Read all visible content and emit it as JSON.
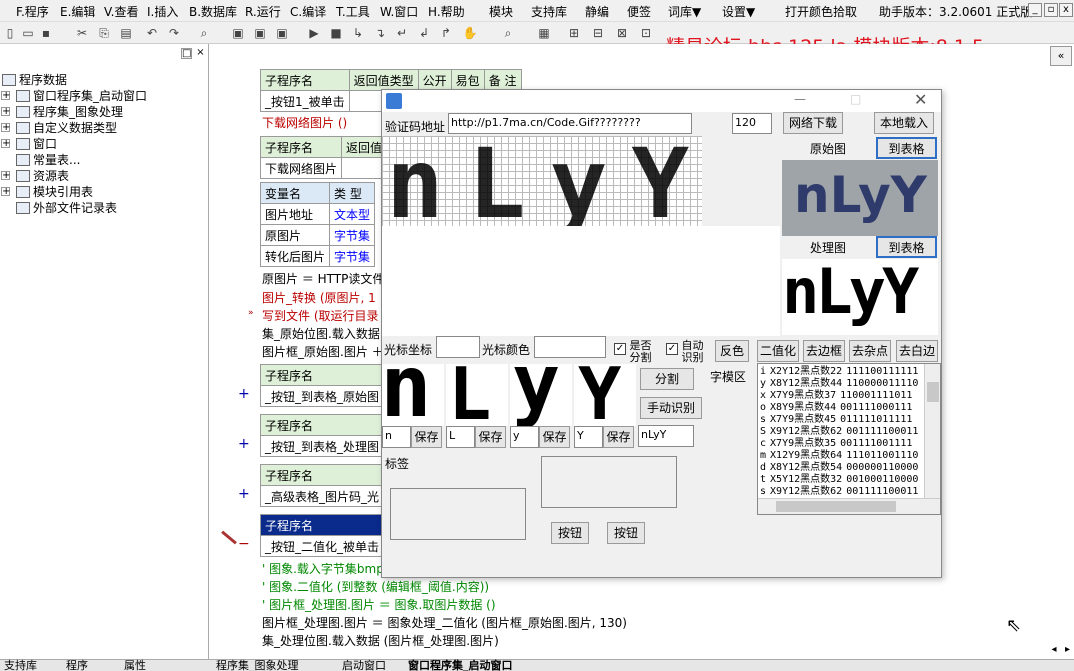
{
  "menu": {
    "items": [
      "F.程序",
      "E.编辑",
      "V.查看",
      "I.插入",
      "B.数据库",
      "R.运行",
      "C.编译",
      "T.工具",
      "W.窗口",
      "H.帮助",
      "模块",
      "支持库",
      "静编",
      "便签",
      "词库▼",
      "设置▼",
      "打开颜色拾取",
      "助手版本：3.2.0601 正式版"
    ],
    "win_min": "_",
    "win_restore": "▫",
    "win_close": "x"
  },
  "watermark": "精易论坛 bbs.125.la 模块版本:8.1.5",
  "tree": {
    "pane_btns": [
      "□",
      "×"
    ],
    "root": "程序数据",
    "items": [
      "窗口程序集_启动窗口",
      "程序集_图象处理",
      "自定义数据类型",
      "窗口",
      "常量表...",
      "资源表",
      "模块引用表",
      "外部文件记录表"
    ]
  },
  "editor": {
    "table1": {
      "headers": [
        "子程序名",
        "返回值类型",
        "公开",
        "易包",
        "备 注"
      ],
      "row": "_按钮1_被单击"
    },
    "line1": "下载网络图片 ()",
    "table2": {
      "headers": [
        "子程序名",
        "返回值"
      ],
      "row": "下载网络图片"
    },
    "table3": {
      "headers": [
        "变量名",
        "类 型"
      ],
      "rows": [
        [
          "图片地址",
          "文本型"
        ],
        [
          "原图片",
          "字节集"
        ],
        [
          "转化后图片",
          "字节集"
        ]
      ]
    },
    "code1": [
      "原图片 ＝ HTTP读文件",
      "图片_转换 (原图片, 1",
      "写到文件 (取运行目录",
      "集_原始位图.载入数据",
      "图片框_原始图.图片 ＋"
    ],
    "sub1": {
      "header": "子程序名",
      "name": "_按钮_到表格_原始图"
    },
    "sub2": {
      "header": "子程序名",
      "name": "_按钮_到表格_处理图"
    },
    "sub3": {
      "header": "子程序名",
      "name": "_高级表格_图片码_光"
    },
    "sub4": {
      "header": "子程序名",
      "name": "_按钮_二值化_被单击"
    },
    "code2": [
      "' 图象.载入字节集bmp",
      "' 图象.二值化 (到整数 (编辑框_阈值.内容))",
      "' 图片框_处理图.图片 ＝ 图象.取图片数据 ()",
      "图片框_处理图.图片 ＝ 图象处理_二值化 (图片框_原始图.图片, 130)",
      "集_处理位图.载入数据 (图片框_处理图.图片)"
    ]
  },
  "dialog": {
    "url_label": "验证码地址",
    "url_value": "http://p1.7ma.cn/Code.Gif????????",
    "size_value": "120",
    "btn_download": "网络下载",
    "btn_local": "本地载入",
    "big_text": "nLyY",
    "orig_label": "原始图",
    "btn_to_table1": "到表格",
    "proc_label": "处理图",
    "btn_to_table2": "到表格",
    "orig_text": "nLyY",
    "proc_text": "nLyY",
    "cursor_coord_label": "光标坐标",
    "cursor_color_label": "光标颜色",
    "chk_split": "是否分割",
    "chk_auto": "自动识别",
    "btn_invert": "反色",
    "btn_binarize": "二值化",
    "btn_border": "去边框",
    "btn_noise": "去杂点",
    "btn_white": "去白边",
    "chars": [
      "n",
      "L",
      "y",
      "Y"
    ],
    "save_label": "保存",
    "btn_split": "分割",
    "btn_manual": "手动识别",
    "result": "nLyY",
    "dict_label": "字模区",
    "tag_label": "标签",
    "btn_a": "按钮",
    "btn_b": "按钮",
    "dict_rows": [
      [
        "i",
        "X2Y12黑点数22",
        "111100111111"
      ],
      [
        "y",
        "X8Y12黑点数44",
        "110000011110"
      ],
      [
        "x",
        "X7Y9黑点数37",
        "110001111011"
      ],
      [
        "o",
        "X8Y9黑点数44",
        "001111000111"
      ],
      [
        "s",
        "X7Y9黑点数45",
        "011111011111"
      ],
      [
        "S",
        "X9Y12黑点数62",
        "001111100011"
      ],
      [
        "c",
        "X7Y9黑点数35",
        "001111001111"
      ],
      [
        "m",
        "X12Y9黑点数64",
        "111011001110"
      ],
      [
        "d",
        "X8Y12黑点数54",
        "000000110000"
      ],
      [
        "t",
        "X5Y12黑点数32",
        "001000110000"
      ],
      [
        "s",
        "X9Y12黑点数62",
        "001111100011"
      ]
    ]
  },
  "status": {
    "tabs": [
      "支持库",
      "程序",
      "属性"
    ],
    "doc_tabs": [
      "程序集_图象处理",
      "启动窗口",
      "窗口程序集_启动窗口"
    ]
  }
}
